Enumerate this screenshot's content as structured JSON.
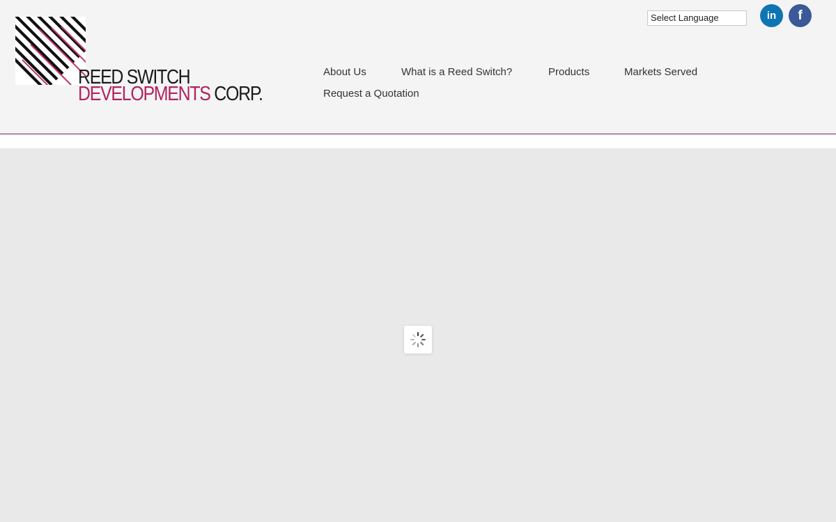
{
  "logo": {
    "line1": "REED SWITCH",
    "line2": "DEVELOPMENTS",
    "line2_suffix": " CORP.",
    "brand_color": "#b1235e"
  },
  "language": {
    "selected": "Select Language"
  },
  "social": {
    "linkedin_glyph": "in",
    "facebook_glyph": "f",
    "linkedin_color": "#0f75b2",
    "facebook_color": "#3b5998"
  },
  "nav": {
    "items": [
      "About Us",
      "What is a Reed Switch?",
      "Products",
      "Markets Served",
      "Request a Quotation"
    ]
  },
  "colors": {
    "header_bg": "#f4f4f5",
    "header_border": "#7b1d62",
    "content_bg": "#e9e9e9"
  },
  "icons": {
    "loader": "spinner-icon"
  }
}
